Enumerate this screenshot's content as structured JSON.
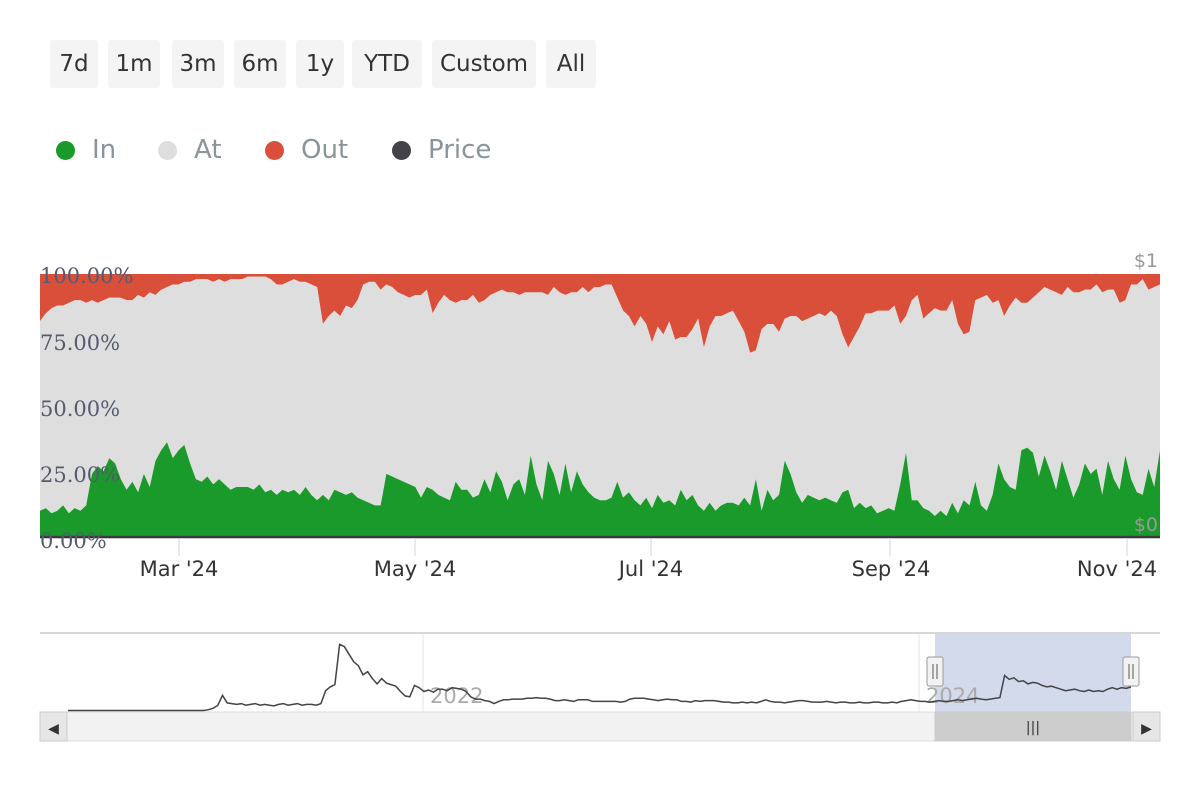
{
  "range_buttons": [
    "7d",
    "1m",
    "3m",
    "6m",
    "1y",
    "YTD",
    "Custom",
    "All"
  ],
  "colors": {
    "in": "#1a9a2a",
    "at": "#dedede",
    "out": "#d94f3a",
    "price": "#434348",
    "navigator_mask": "#cdd6ea"
  },
  "chart_data": {
    "type": "area",
    "stacking": "percent",
    "series": [
      {
        "name": "In",
        "values": [
          10,
          11,
          9,
          10,
          12,
          9,
          11,
          10,
          12,
          24,
          27,
          25,
          30,
          28,
          22,
          18,
          21,
          17,
          24,
          19,
          29,
          33,
          36,
          30,
          33,
          35,
          28,
          22,
          21,
          23,
          20,
          22,
          20,
          18,
          19,
          19,
          19,
          18,
          20,
          17,
          18,
          16,
          18,
          17,
          18,
          16,
          19,
          16,
          14,
          16,
          14,
          18,
          17,
          16,
          17,
          15,
          14,
          13,
          12,
          12,
          24,
          23,
          22,
          21,
          20,
          19,
          15,
          19,
          18,
          16,
          15,
          14,
          21,
          18,
          18,
          15,
          16,
          22,
          17,
          25,
          21,
          14,
          20,
          22,
          16,
          31,
          20,
          14,
          29,
          24,
          16,
          28,
          17,
          25,
          20,
          17,
          15,
          14,
          14,
          15,
          21,
          15,
          17,
          14,
          12,
          15,
          11,
          16,
          13,
          14,
          12,
          18,
          14,
          16,
          12,
          10,
          13,
          10,
          12,
          13,
          13,
          12,
          15,
          12,
          22,
          10,
          18,
          14,
          16,
          29,
          24,
          17,
          13,
          16,
          15,
          14,
          15,
          14,
          13,
          17,
          18,
          11,
          13,
          11,
          12,
          9,
          10,
          11,
          10,
          20,
          32,
          14,
          14,
          11,
          10,
          8,
          10,
          8,
          13,
          9,
          14,
          12,
          21,
          12,
          10,
          16,
          28,
          22,
          19,
          18,
          33,
          34,
          32,
          23,
          31,
          25,
          18,
          29,
          22,
          15,
          20,
          28,
          24,
          26,
          16,
          29,
          22,
          18,
          31,
          22,
          17,
          16,
          26,
          19,
          33
        ],
        "color": "#1a9a2a"
      },
      {
        "name": "At",
        "values": [
          72,
          74,
          78,
          78,
          76,
          80,
          79,
          80,
          77,
          66,
          62,
          65,
          61,
          63,
          69,
          72,
          69,
          75,
          67,
          74,
          63,
          61,
          59,
          66,
          63,
          62,
          69,
          76,
          77,
          75,
          77,
          76,
          77,
          80,
          79,
          79,
          80,
          81,
          79,
          82,
          80,
          80,
          78,
          80,
          80,
          81,
          78,
          80,
          81,
          65,
          70,
          68,
          67,
          72,
          70,
          75,
          82,
          84,
          85,
          82,
          72,
          72,
          71,
          71,
          71,
          73,
          77,
          75,
          67,
          73,
          77,
          76,
          68,
          72,
          72,
          77,
          73,
          68,
          75,
          68,
          73,
          79,
          73,
          70,
          77,
          62,
          73,
          79,
          63,
          71,
          77,
          64,
          76,
          68,
          75,
          76,
          80,
          81,
          82,
          81,
          70,
          71,
          67,
          66,
          72,
          66,
          63,
          64,
          64,
          68,
          63,
          58,
          62,
          63,
          71,
          62,
          67,
          74,
          72,
          72,
          73,
          70,
          63,
          58,
          49,
          69,
          63,
          67,
          62,
          54,
          60,
          67,
          69,
          67,
          69,
          71,
          69,
          72,
          71,
          60,
          54,
          65,
          67,
          74,
          73,
          77,
          76,
          75,
          78,
          61,
          52,
          76,
          78,
          72,
          75,
          79,
          76,
          78,
          77,
          72,
          63,
          66,
          69,
          79,
          82,
          73,
          62,
          62,
          69,
          73,
          56,
          55,
          59,
          70,
          64,
          69,
          75,
          63,
          73,
          78,
          73,
          66,
          70,
          70,
          77,
          65,
          72,
          71,
          59,
          74,
          79,
          82,
          68,
          76,
          63
        ],
        "color": "#dedede"
      },
      {
        "name": "Out",
        "values": [
          18,
          15,
          13,
          12,
          12,
          11,
          10,
          10,
          11,
          10,
          11,
          10,
          9,
          9,
          9,
          10,
          10,
          8,
          9,
          7,
          8,
          6,
          5,
          4,
          4,
          3,
          3,
          2,
          2,
          2,
          3,
          2,
          3,
          2,
          2,
          2,
          1,
          1,
          1,
          1,
          2,
          4,
          4,
          3,
          2,
          3,
          3,
          4,
          5,
          19,
          16,
          14,
          16,
          12,
          13,
          10,
          4,
          3,
          3,
          6,
          4,
          5,
          7,
          8,
          9,
          8,
          8,
          6,
          15,
          11,
          8,
          10,
          11,
          10,
          10,
          8,
          11,
          10,
          8,
          7,
          6,
          7,
          7,
          8,
          7,
          7,
          7,
          7,
          8,
          5,
          7,
          8,
          7,
          7,
          5,
          7,
          5,
          5,
          4,
          4,
          9,
          14,
          16,
          20,
          16,
          19,
          26,
          20,
          23,
          18,
          25,
          24,
          24,
          21,
          17,
          28,
          20,
          16,
          16,
          15,
          14,
          18,
          22,
          30,
          29,
          21,
          19,
          19,
          22,
          17,
          16,
          16,
          18,
          17,
          16,
          15,
          16,
          14,
          16,
          23,
          28,
          24,
          20,
          15,
          15,
          14,
          14,
          14,
          12,
          19,
          16,
          10,
          8,
          17,
          15,
          13,
          14,
          14,
          10,
          19,
          23,
          22,
          10,
          9,
          8,
          11,
          10,
          16,
          12,
          9,
          11,
          11,
          9,
          7,
          5,
          6,
          7,
          8,
          5,
          7,
          7,
          6,
          6,
          4,
          7,
          6,
          6,
          11,
          10,
          4,
          4,
          2,
          6,
          5,
          4
        ],
        "color": "#d94f3a"
      },
      {
        "name": "Price",
        "values": [
          0.0012,
          0.0012,
          0.0013,
          0.0012,
          0.0011,
          0.0012,
          0.0013,
          0.0012
        ],
        "color": "#434348"
      }
    ],
    "x_range": [
      "2024-02-01",
      "2024-11-10"
    ],
    "x_ticks": [
      "Mar '24",
      "May '24",
      "Jul '24",
      "Sep '24",
      "Nov '24"
    ],
    "y_ticks": [
      "0.00%",
      "25.00%",
      "50.00%",
      "75.00%",
      "100.00%"
    ],
    "y_right_ticks": [
      "$0",
      "$1"
    ],
    "ylim": [
      0,
      100
    ],
    "legend_position": "top-left",
    "grid": false,
    "navigator": {
      "labels": [
        "2022",
        "2024"
      ],
      "series": [
        0.02,
        0.02,
        0.02,
        0.02,
        0.02,
        0.02,
        0.02,
        0.02,
        0.02,
        0.02,
        0.02,
        0.02,
        0.02,
        0.02,
        0.02,
        0.02,
        0.02,
        0.02,
        0.02,
        0.02,
        0.02,
        0.02,
        0.02,
        0.02,
        0.02,
        0.02,
        0.02,
        0.02,
        0.02,
        0.02,
        0.03,
        0.05,
        0.09,
        0.22,
        0.12,
        0.11,
        0.1,
        0.11,
        0.09,
        0.1,
        0.11,
        0.09,
        0.1,
        0.09,
        0.08,
        0.1,
        0.11,
        0.09,
        0.1,
        0.11,
        0.09,
        0.1,
        0.1,
        0.09,
        0.11,
        0.28,
        0.33,
        0.36,
        0.89,
        0.86,
        0.76,
        0.66,
        0.61,
        0.49,
        0.53,
        0.44,
        0.37,
        0.44,
        0.38,
        0.36,
        0.34,
        0.27,
        0.21,
        0.2,
        0.35,
        0.32,
        0.27,
        0.29,
        0.26,
        0.3,
        0.3,
        0.28,
        0.32,
        0.31,
        0.3,
        0.27,
        0.2,
        0.17,
        0.17,
        0.15,
        0.14,
        0.11,
        0.14,
        0.16,
        0.16,
        0.17,
        0.17,
        0.17,
        0.18,
        0.18,
        0.19,
        0.18,
        0.18,
        0.17,
        0.15,
        0.15,
        0.16,
        0.15,
        0.14,
        0.16,
        0.16,
        0.16,
        0.14,
        0.14,
        0.14,
        0.14,
        0.14,
        0.14,
        0.13,
        0.14,
        0.17,
        0.18,
        0.18,
        0.18,
        0.17,
        0.16,
        0.15,
        0.16,
        0.17,
        0.16,
        0.16,
        0.14,
        0.14,
        0.13,
        0.15,
        0.14,
        0.15,
        0.15,
        0.15,
        0.14,
        0.13,
        0.13,
        0.12,
        0.12,
        0.13,
        0.12,
        0.13,
        0.12,
        0.14,
        0.16,
        0.14,
        0.13,
        0.13,
        0.12,
        0.13,
        0.14,
        0.15,
        0.15,
        0.14,
        0.13,
        0.13,
        0.13,
        0.14,
        0.13,
        0.12,
        0.13,
        0.13,
        0.12,
        0.12,
        0.13,
        0.12,
        0.12,
        0.13,
        0.13,
        0.12,
        0.12,
        0.13,
        0.12,
        0.14,
        0.15,
        0.16,
        0.15,
        0.14,
        0.14,
        0.13,
        0.14,
        0.15,
        0.14,
        0.14,
        0.15,
        0.16,
        0.15,
        0.16,
        0.17,
        0.18,
        0.17,
        0.16,
        0.17,
        0.18,
        0.19,
        0.48,
        0.43,
        0.45,
        0.4,
        0.41,
        0.37,
        0.39,
        0.38,
        0.35,
        0.33,
        0.34,
        0.32,
        0.3,
        0.28,
        0.29,
        0.3,
        0.28,
        0.27,
        0.29,
        0.27,
        0.28,
        0.27,
        0.3,
        0.32,
        0.3,
        0.32,
        0.31,
        0.33
      ]
    }
  },
  "navigator_handle_grip": "|||",
  "scroll_left_arrow": "◀",
  "scroll_right_arrow": "▶"
}
